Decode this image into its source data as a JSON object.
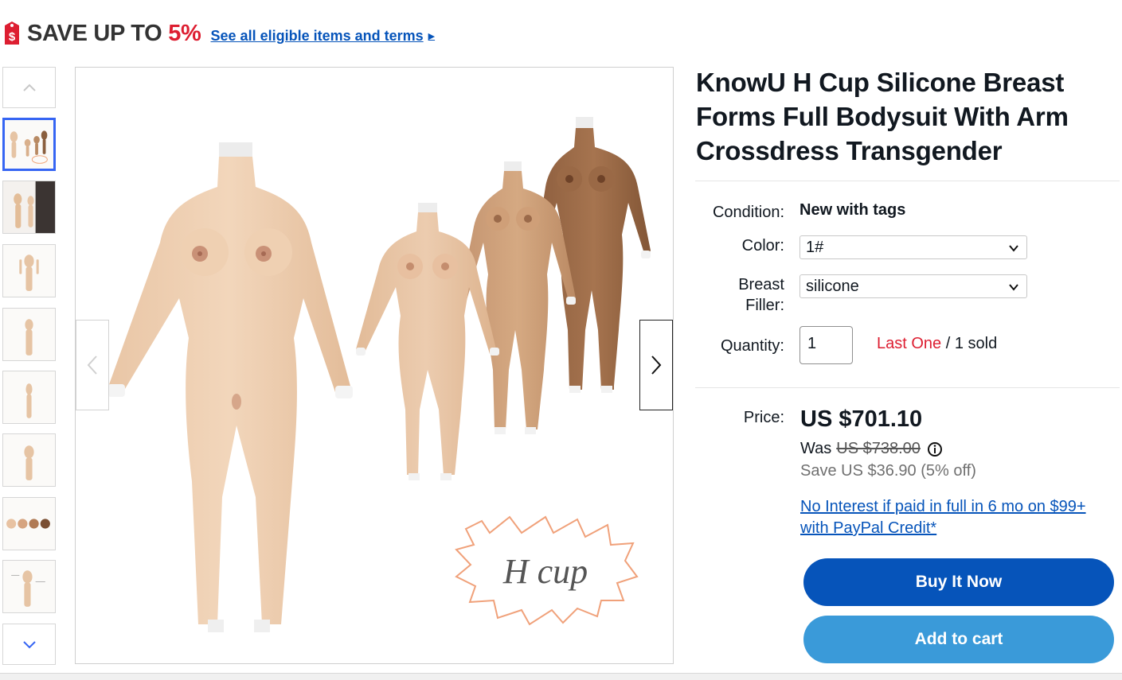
{
  "promo": {
    "prefix": "SAVE UP TO ",
    "percent": "5%",
    "link": "See all eligible items and terms"
  },
  "gallery": {
    "thumbnail_count": 8,
    "active_index": 0
  },
  "product": {
    "title": "KnowU H Cup Silicone Breast Forms Full Bodysuit With Arm Crossdress Transgender",
    "image_caption": "H cup"
  },
  "details": {
    "condition_label": "Condition:",
    "condition_value": "New with tags",
    "color_label": "Color:",
    "color_value": "1#",
    "filler_label_line1": "Breast",
    "filler_label_line2": "Filler:",
    "filler_value": "silicone",
    "quantity_label": "Quantity:",
    "quantity_value": "1",
    "stock_last": "Last One",
    "stock_sold": " / 1 sold"
  },
  "pricing": {
    "price_label": "Price:",
    "price": "US $701.10",
    "was_label": "Was",
    "was_price": "US $738.00",
    "save_text": "Save US $36.90 (5% off)",
    "paypal_text": "No Interest if paid in full in 6 mo on $99+ with PayPal Credit*"
  },
  "actions": {
    "buy_now": "Buy It Now",
    "add_to_cart": "Add to cart"
  },
  "colors": {
    "accent_blue": "#0654ba",
    "cart_blue": "#3a9ad9",
    "sale_red": "#dd1e31",
    "active_thumb_border": "#3665f3"
  }
}
